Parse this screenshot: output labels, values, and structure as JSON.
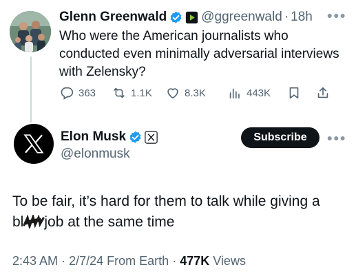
{
  "replied_tweet": {
    "author_name": "Glenn Greenwald",
    "handle": "@ggreenwald",
    "separator": "·",
    "time": "18h",
    "text": "Who were the American journalists who conducted even minimally adversarial interviews with Zelensky?",
    "stats": {
      "replies": "363",
      "reposts": "1.1K",
      "likes": "8.3K",
      "views": "443K"
    },
    "icons": [
      "verified-badge-icon",
      "rumble-badge-icon",
      "more-icon",
      "reply-icon",
      "repost-icon",
      "like-icon",
      "views-icon",
      "bookmark-icon",
      "share-icon"
    ]
  },
  "main_tweet": {
    "author_name": "Elon Musk",
    "handle": "@elonmusk",
    "subscribe_label": "Subscribe",
    "text_line1": "To be fair, it’s hard for them to talk while giving a",
    "text_prefix": "bl",
    "text_suffix": "job at the same time",
    "meta": {
      "time": "2:43 AM",
      "sep1": "·",
      "date": "2/7/24",
      "source": "From Earth",
      "sep2": "·",
      "views_count": "477K",
      "views_label": "Views"
    },
    "icons": [
      "x-logo-avatar",
      "verified-badge-icon",
      "x-affiliate-badge-icon",
      "more-icon",
      "redaction-scribble"
    ]
  },
  "colors": {
    "text": "#0f1419",
    "secondary": "#536471",
    "verified_blue": "#1d9bf0",
    "rumble_green": "#85c742",
    "thread_line": "#cfd9de"
  }
}
